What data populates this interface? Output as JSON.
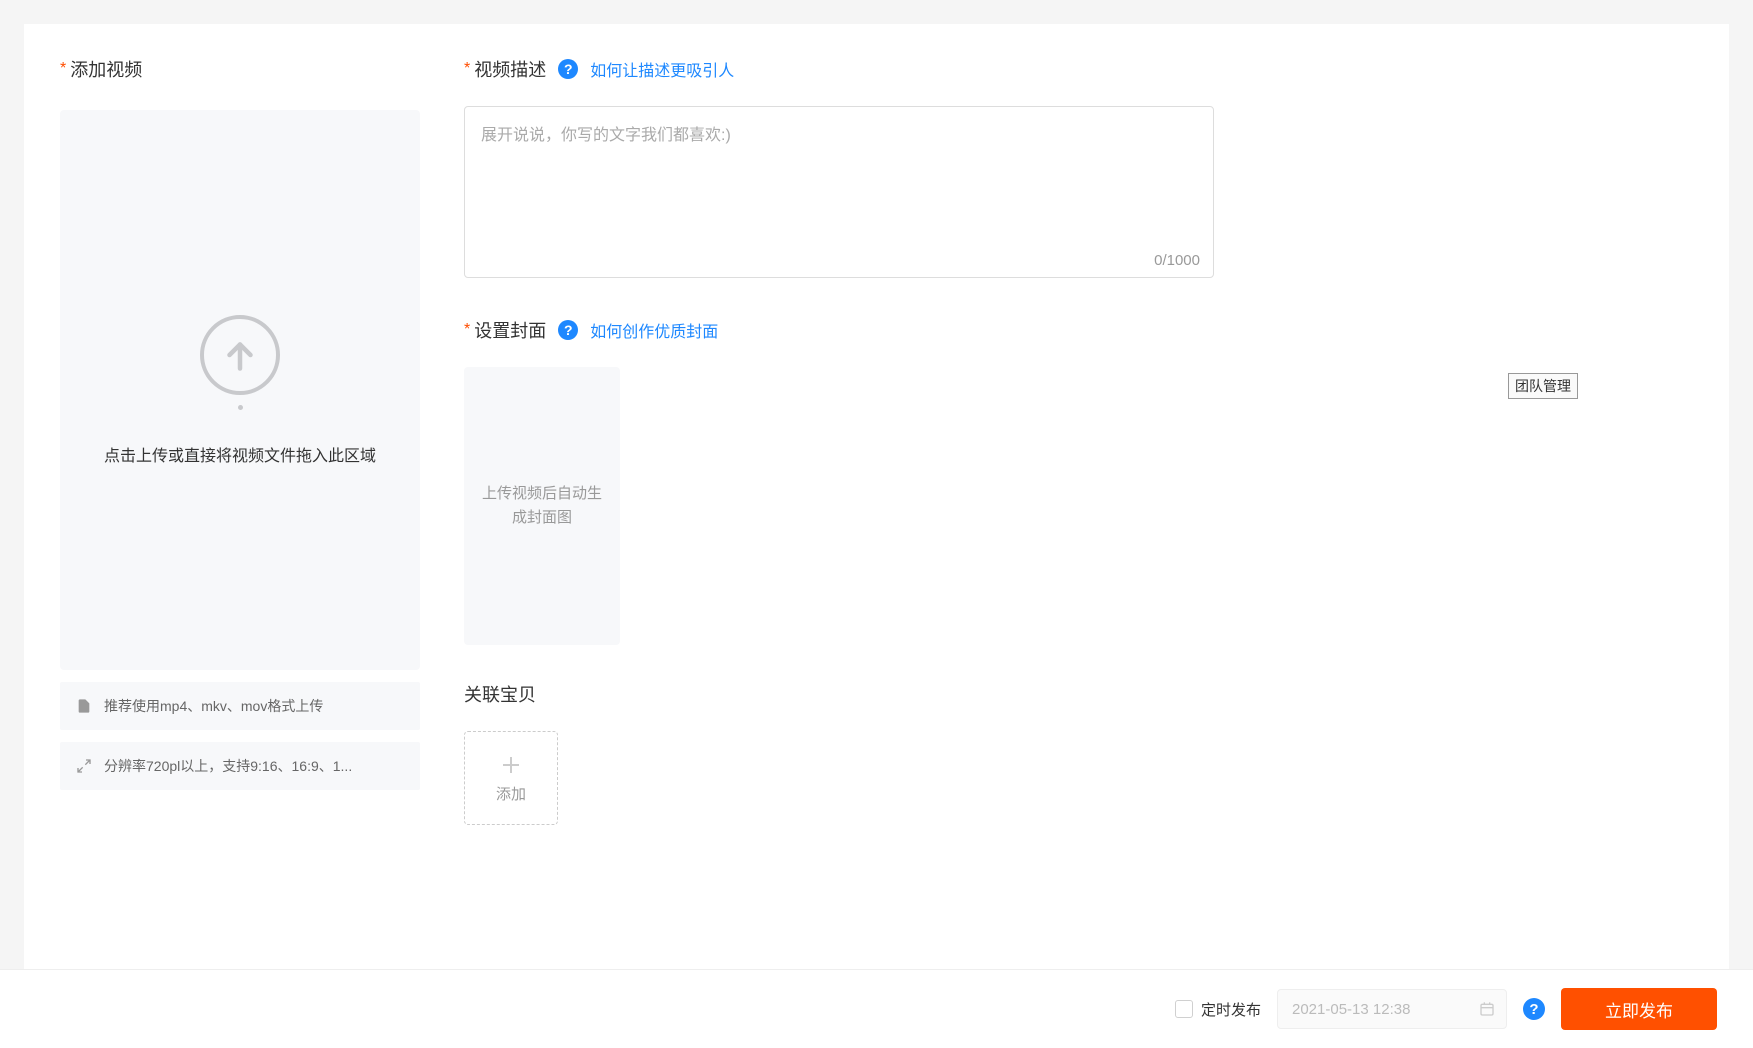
{
  "left": {
    "title": "添加视频",
    "upload_text": "点击上传或直接将视频文件拖入此区域",
    "info1": "推荐使用mp4、mkv、mov格式上传",
    "info2": "分辨率720pl以上，支持9:16、16:9、1..."
  },
  "description": {
    "title": "视频描述",
    "help_link": "如何让描述更吸引人",
    "placeholder": "展开说说，你写的文字我们都喜欢:)",
    "counter": "0/1000"
  },
  "cover": {
    "title": "设置封面",
    "help_link": "如何创作优质封面",
    "placeholder_text": "上传视频后自动生成封面图",
    "team_badge": "团队管理"
  },
  "related": {
    "title": "关联宝贝",
    "add_label": "添加"
  },
  "footer": {
    "schedule_label": "定时发布",
    "date_value": "2021-05-13 12:38",
    "publish_btn": "立即发布"
  }
}
